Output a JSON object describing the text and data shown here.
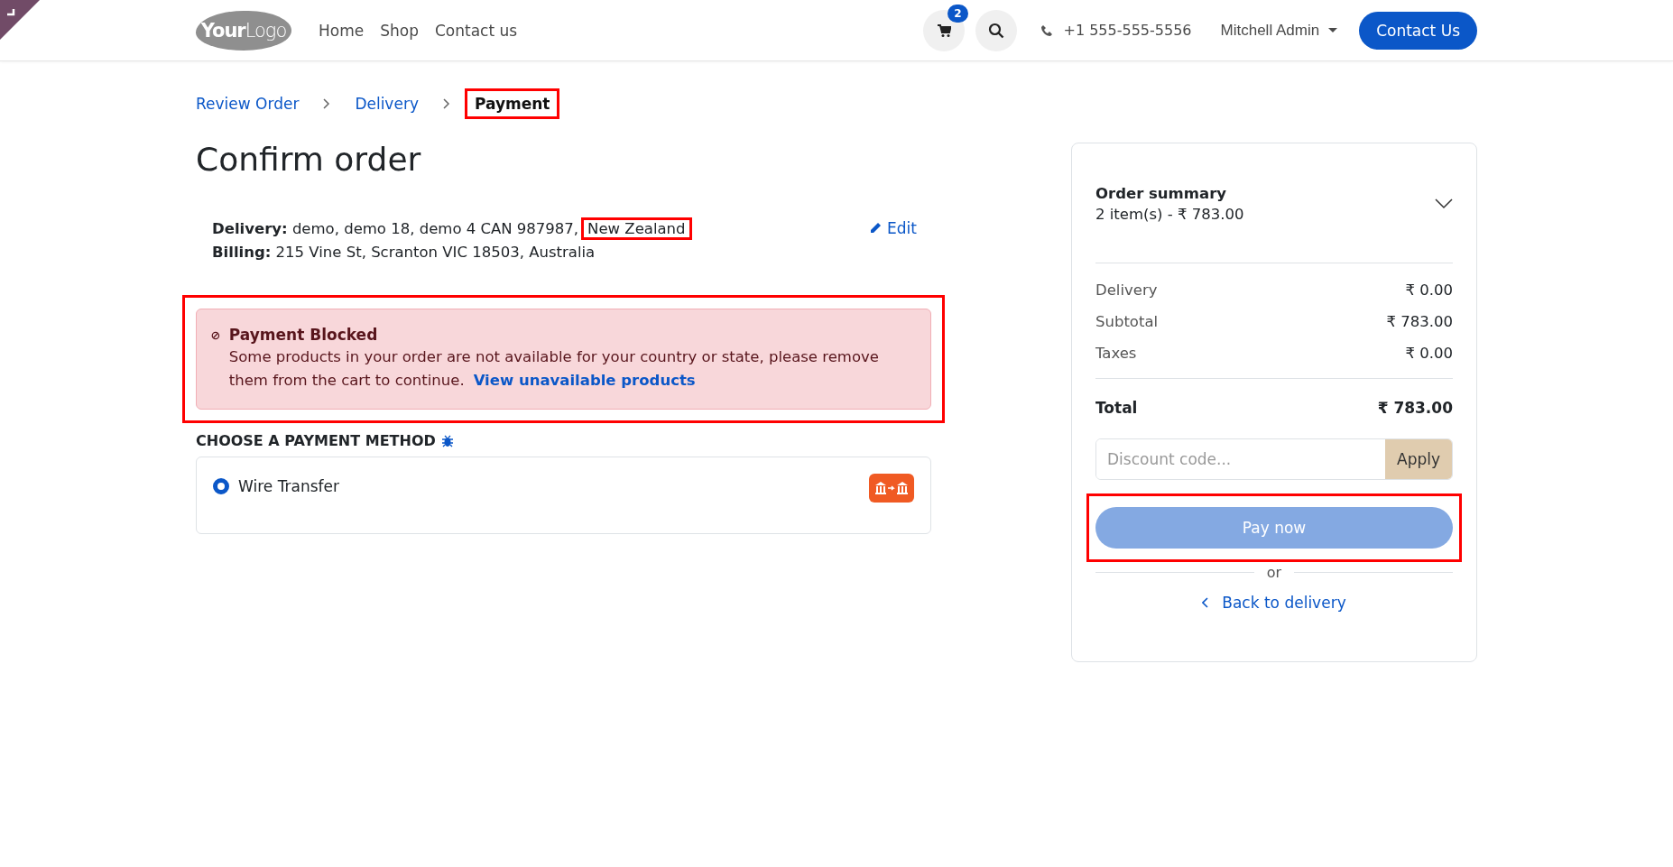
{
  "header": {
    "logo": {
      "bold": "Your",
      "light": "Logo"
    },
    "nav": [
      {
        "label": "Home"
      },
      {
        "label": "Shop"
      },
      {
        "label": "Contact us"
      }
    ],
    "cart_count": "2",
    "phone": "+1 555-555-5556",
    "user": "Mitchell Admin",
    "cta": "Contact Us"
  },
  "breadcrumb": [
    {
      "label": "Review Order",
      "selected": false,
      "highlighted": false
    },
    {
      "label": "Delivery",
      "selected": false,
      "highlighted": false
    },
    {
      "label": "Payment",
      "selected": true,
      "highlighted": true
    }
  ],
  "title": "Confirm order",
  "addresses": [
    {
      "label": "Delivery:",
      "value": "demo, demo 18, demo 4 CAN 987987,",
      "country": "New Zealand",
      "highlighted": true
    },
    {
      "label": "Billing:",
      "value": "215 Vine St, Scranton VIC 18503, Australia"
    }
  ],
  "edit_link": "Edit",
  "alert": {
    "title": "Payment Blocked",
    "message": "Some products in your order are not available for your country or state, please remove them from the cart to continue.",
    "link": "View unavailable products",
    "highlighted": true
  },
  "payment_heading": "CHOOSE A PAYMENT METHOD",
  "payment_methods": [
    {
      "label": "Wire Transfer",
      "selected": true
    }
  ],
  "summary": {
    "title": "Order summary",
    "items": "2 item(s) -  ₹ 783.00",
    "expanded": false,
    "lines": [
      {
        "label": "Delivery",
        "amount": "₹ 0.00"
      },
      {
        "label": "Subtotal",
        "amount": "₹ 783.00"
      },
      {
        "label": "Taxes",
        "amount": "₹ 0.00"
      }
    ],
    "total": {
      "label": "Total",
      "amount": "₹ 783.00"
    },
    "discount": {
      "placeholder": "Discount code...",
      "button": "Apply"
    },
    "pay": {
      "label": "Pay now",
      "disabled": true,
      "highlighted": true
    },
    "separator": "or",
    "back": "Back to delivery"
  }
}
